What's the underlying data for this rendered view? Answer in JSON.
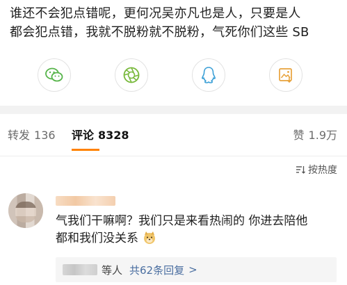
{
  "post": {
    "lines": [
      "谁还不会犯点错呢，更何况吴亦凡也是人，只要是人",
      "都会犯点错，我就不脱粉就不脱粉，气死你们这些 SB"
    ]
  },
  "share": {
    "buttons": [
      {
        "icon": "wechat-icon"
      },
      {
        "icon": "moments-icon"
      },
      {
        "icon": "qq-icon"
      },
      {
        "icon": "save-image-icon"
      }
    ]
  },
  "tabs": {
    "repost_label": "转发",
    "repost_count": "136",
    "comment_label": "评论",
    "comment_count": "8328",
    "like_label": "赞",
    "like_count": "1.9万",
    "active_color": "#ff8200"
  },
  "sort": {
    "label": "按热度"
  },
  "comment": {
    "lines": [
      "气我们干嘛啊？我们只是来看热闹的 你进去陪他",
      "都和我们没关系"
    ],
    "emoji": "doge-emoji",
    "reply_text": "等人",
    "reply_count": "共62条回复",
    "reply_arrow": ">"
  }
}
